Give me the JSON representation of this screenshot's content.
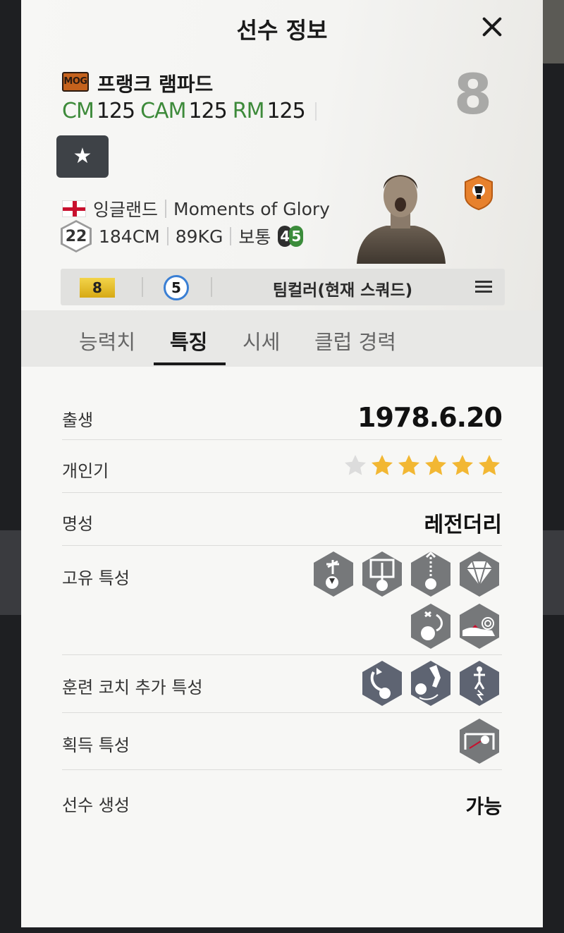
{
  "modal": {
    "title": "선수 정보",
    "close_icon": "close-icon"
  },
  "player": {
    "season_badge": "MOG",
    "name": "프랭크 램파드",
    "number": "8",
    "positions": [
      {
        "label": "CM",
        "value": "125"
      },
      {
        "label": "CAM",
        "value": "125"
      },
      {
        "label": "RM",
        "value": "125"
      }
    ],
    "favorite_icon": "star-icon",
    "nation": "잉글랜드",
    "season": "Moments of Glory",
    "age": "22",
    "height": "184CM",
    "weight": "89KG",
    "body_type": "보통",
    "weak_foot": "4",
    "skill_moves": "5"
  },
  "info_bar": {
    "grade": "8",
    "level": "5",
    "team_color": "팀컬러(현재 스쿼드)",
    "menu_icon": "menu-icon"
  },
  "tabs": [
    {
      "label": "능력치",
      "active": false
    },
    {
      "label": "특징",
      "active": true
    },
    {
      "label": "시세",
      "active": false
    },
    {
      "label": "클럽 경력",
      "active": false
    }
  ],
  "details": {
    "birth_label": "출생",
    "birth_value": "1978.6.20",
    "popularity_label": "개인기",
    "popularity_stars": 5,
    "popularity_max": 6,
    "reputation_label": "명성",
    "reputation_value": "레전더리",
    "traits_label": "고유 특성",
    "traits": [
      "long-shot-trait-icon",
      "power-header-trait-icon",
      "finesse-shot-trait-icon",
      "diamond-trait-icon",
      "outside-foot-trait-icon",
      "speed-dribble-trait-icon"
    ],
    "coach_traits_label": "훈련 코치 추가 특성",
    "coach_traits": [
      "curve-shot-trait-icon",
      "volley-trait-icon",
      "sprint-trait-icon"
    ],
    "acquired_traits_label": "획득 특성",
    "acquired_traits": [
      "goal-shot-trait-icon"
    ],
    "creation_label": "선수 생성",
    "creation_value": "가능"
  },
  "colors": {
    "position_green": "#3d8a3a",
    "star_gold": "#f2b733",
    "trait_grey": "#76787a",
    "grade_gold": "#e8c22c",
    "level_blue": "#3a7fd4"
  }
}
